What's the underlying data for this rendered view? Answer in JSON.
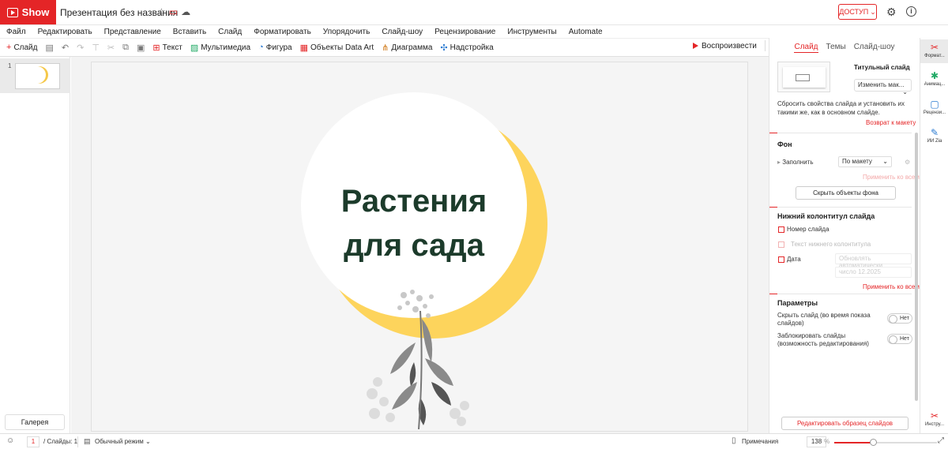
{
  "app": {
    "name": "Show",
    "doc_title": "Презентация без названия",
    "access_label": "ДОСТУП"
  },
  "menu": [
    "Файл",
    "Редактировать",
    "Представление",
    "Вставить",
    "Слайд",
    "Форматировать",
    "Упорядочить",
    "Слайд-шоу",
    "Рецензирование",
    "Инструменты",
    "Automate"
  ],
  "toolbar": {
    "add_slide": "Слайд",
    "text": "Текст",
    "media": "Мультимедиа",
    "shape": "Фигура",
    "dataart": "Объекты Data Art",
    "chart": "Диаграмма",
    "addon": "Надстройка",
    "play": "Воспроизвести"
  },
  "slides_pane": {
    "thumb_number": "1",
    "gallery": "Галерея"
  },
  "slide": {
    "title_line1": "Растения",
    "title_line2": "для сада"
  },
  "colors": {
    "accent": "#e42527",
    "moon": "#fdd45c",
    "title": "#1c3b2b"
  },
  "format_panel": {
    "tabs": [
      "Слайд",
      "Темы",
      "Слайд-шоу"
    ],
    "layout_name": "Титульный слайд",
    "layout_select": "Изменить мак...",
    "reset_desc": "Сбросить свойства слайда и установить их такими же, как в основном слайде.",
    "reset_link": "Возврат к макету",
    "bg_title": "Фон",
    "fill_label": "Заполнить",
    "fill_select": "По макету",
    "apply_all": "Применить ко всем",
    "hide_bg_btn": "Скрыть объекты фона",
    "footer_title": "Нижний колонтитул слайда",
    "slide_number": "Номер слайда",
    "footer_text": "Текст нижнего колонтитула",
    "date": "Дата",
    "date_auto": "Обновлять автоматически",
    "date_value": "число 12.2025",
    "apply_all_2": "Применить ко всем",
    "params_title": "Параметры",
    "hide_slide": "Скрыть слайд",
    "hide_slide_sub": "(во время показа",
    "hide_slide_sub2": "слайдов)",
    "lock_slide": "Заблокировать слайды",
    "lock_slide_sub": "(возможность редактирования)",
    "toggle_off": "Нет",
    "edit_master": "Редактировать образец слайдов"
  },
  "rail": [
    "Формат...",
    "Анимац...",
    "Рецензи...",
    "ИИ Zia",
    "Инстру..."
  ],
  "status": {
    "page": "1",
    "slides_count": "/ Слайды: 1",
    "view_mode": "Обычный режим",
    "notes": "Примечания",
    "zoom": "138",
    "zoom_pct": "%",
    "zoom_level": 0.38
  }
}
